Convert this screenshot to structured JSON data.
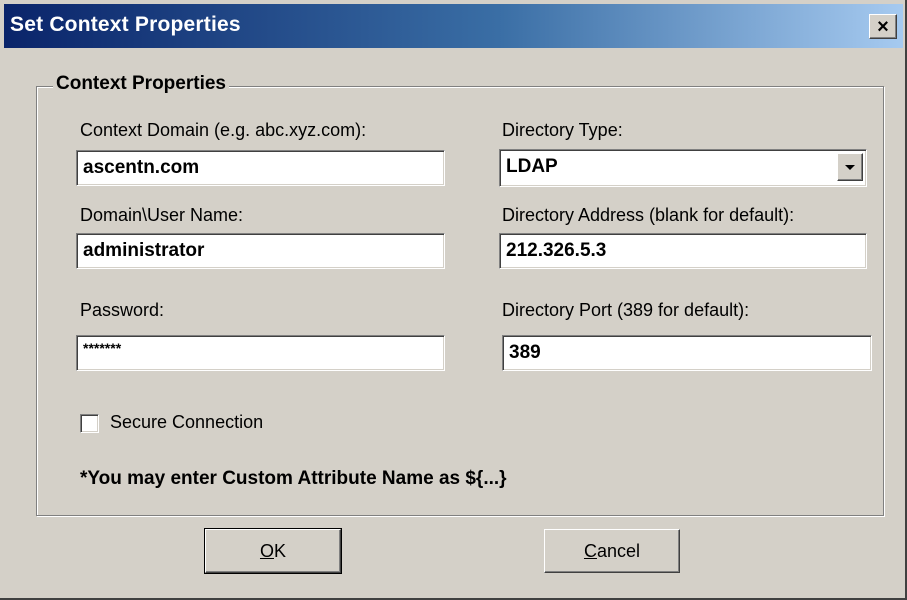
{
  "window": {
    "title": "Set Context Properties",
    "close_glyph": "×"
  },
  "group": {
    "title": "Context Properties"
  },
  "fields": {
    "context_domain": {
      "label": "Context Domain (e.g. abc.xyz.com):",
      "value": "ascentn.com"
    },
    "user_name": {
      "label": "Domain\\User Name:",
      "value": "administrator"
    },
    "password": {
      "label": "Password:",
      "value": "*******"
    },
    "directory_type": {
      "label": "Directory Type:",
      "value": "LDAP"
    },
    "directory_address": {
      "label": "Directory Address (blank for default):",
      "value": "212.326.5.3"
    },
    "directory_port": {
      "label": "Directory Port (389 for default):",
      "value": "389"
    }
  },
  "secure_connection": {
    "label": "Secure Connection",
    "checked": false
  },
  "note": "*You may enter Custom Attribute Name as ${...}",
  "buttons": {
    "ok": {
      "mnemonic": "O",
      "rest": "K"
    },
    "cancel": {
      "mnemonic": "C",
      "rest": "ancel"
    }
  },
  "icons": {
    "close": "close-icon",
    "dropdown": "chevron-down-icon"
  },
  "colors": {
    "title_start": "#0a246a",
    "title_end": "#a6caf0",
    "face": "#d4d0c8"
  }
}
